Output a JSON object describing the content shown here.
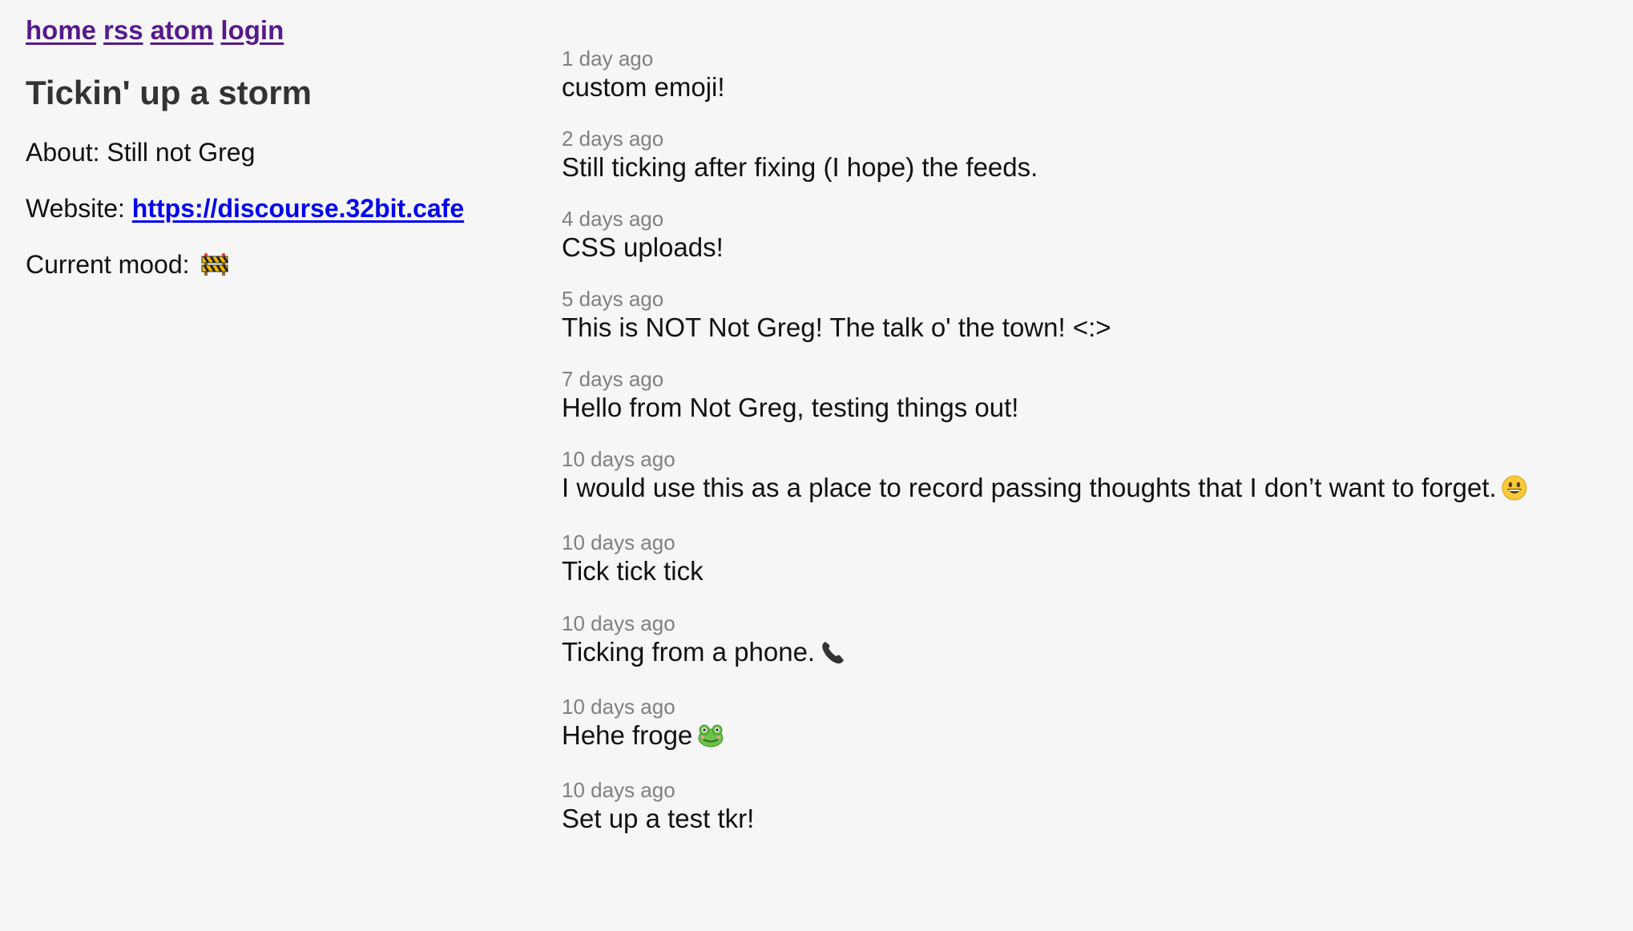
{
  "nav": {
    "home": "home",
    "rss": "rss",
    "atom": "atom",
    "login": "login"
  },
  "profile": {
    "title": "Tickin' up a storm",
    "about_label": "About:",
    "about_value": "Still not Greg",
    "website_label": "Website:",
    "website_url": "https://discourse.32bit.cafe",
    "mood_label": "Current mood:",
    "mood_icon": "construction-barrier-icon"
  },
  "colors": {
    "background": "#f6f6f6",
    "visited_link": "#551a8b",
    "link": "#0000ee",
    "timestamp": "#808080"
  },
  "ticks": [
    {
      "time": "1 day ago",
      "text": "custom emoji!",
      "icon": ""
    },
    {
      "time": "2 days ago",
      "text": "Still ticking after fixing (I hope) the feeds.",
      "icon": ""
    },
    {
      "time": "4 days ago",
      "text": "CSS uploads!",
      "icon": ""
    },
    {
      "time": "5 days ago",
      "text": "This is NOT Not Greg! The talk o' the town! <:>",
      "icon": ""
    },
    {
      "time": "7 days ago",
      "text": "Hello from Not Greg, testing things out!",
      "icon": ""
    },
    {
      "time": "10 days ago",
      "text": "I would use this as a place to record passing thoughts that I don’t want to forget.",
      "icon": "grinning-face-icon"
    },
    {
      "time": "10 days ago",
      "text": "Tick tick tick",
      "icon": ""
    },
    {
      "time": "10 days ago",
      "text": "Ticking from a phone.",
      "icon": "telephone-receiver-icon"
    },
    {
      "time": "10 days ago",
      "text": "Hehe froge",
      "icon": "frog-icon"
    },
    {
      "time": "10 days ago",
      "text": "Set up a test tkr!",
      "icon": ""
    }
  ]
}
